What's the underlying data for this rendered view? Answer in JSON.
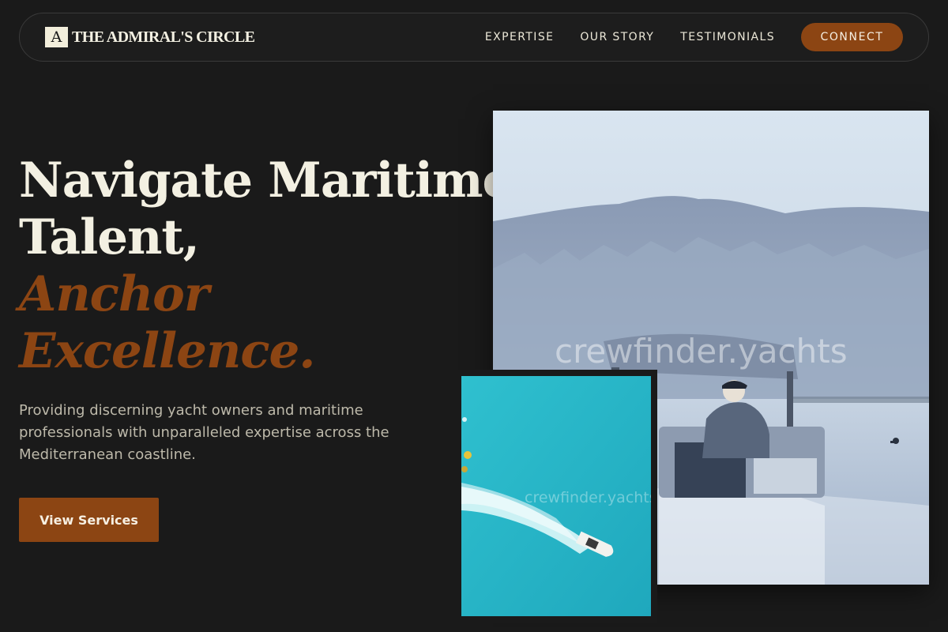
{
  "brand": {
    "mark": "A",
    "name": "THE ADMIRAL'S CIRCLE"
  },
  "nav": {
    "links": [
      "EXPERTISE",
      "OUR STORY",
      "TESTIMONIALS"
    ],
    "cta": "CONNECT"
  },
  "hero": {
    "title_line1": "Navigate Maritime",
    "title_line2": "Talent,",
    "accent_line1": "Anchor",
    "accent_line2": "Excellence.",
    "description": "Providing discerning yacht owners and maritime professionals with unparalleled expertise across the Mediterranean coastline.",
    "cta": "View Services"
  },
  "images": {
    "main_watermark": "crewfinder.yachts",
    "secondary_watermark": "crewfinder.yachts"
  },
  "colors": {
    "background": "#1a1a1a",
    "accent": "#8c4513",
    "text": "#f3f0e2"
  }
}
